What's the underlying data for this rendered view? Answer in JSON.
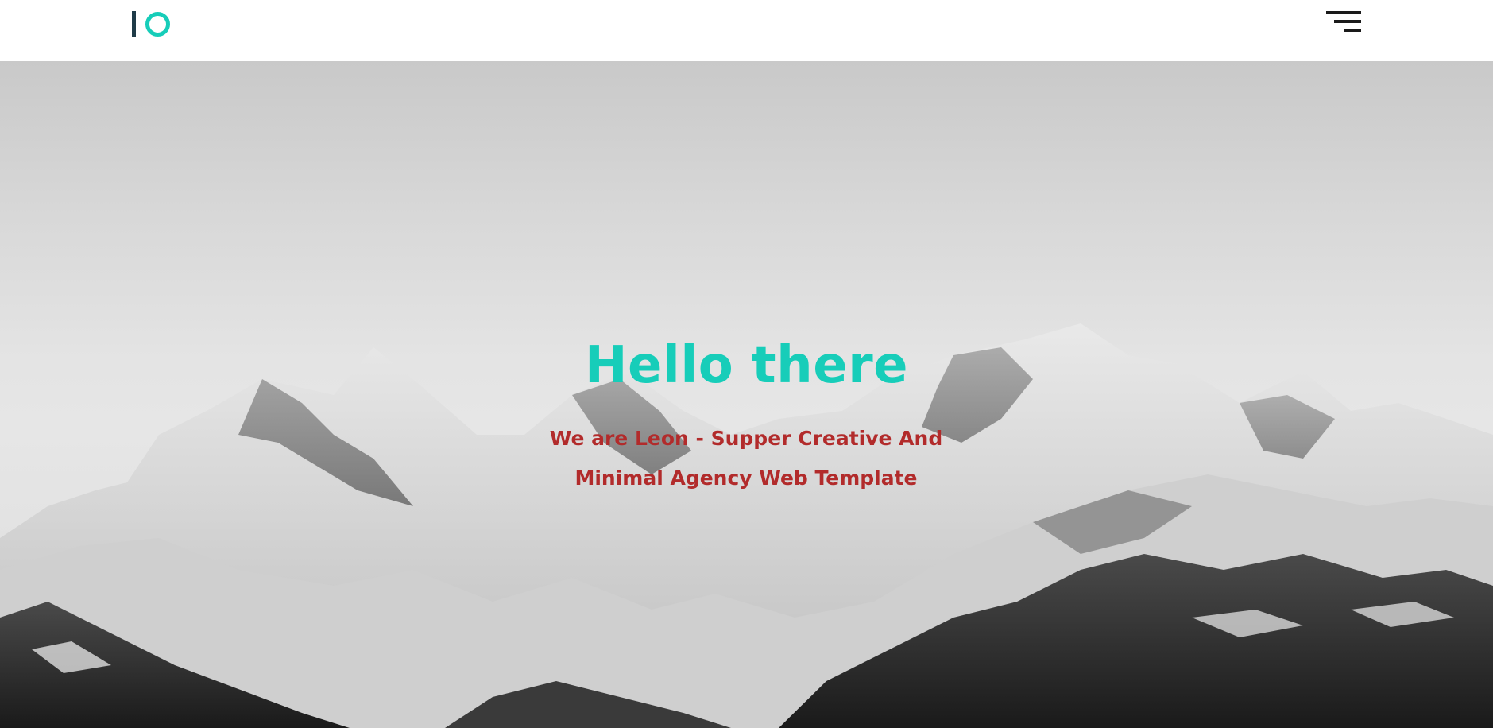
{
  "header": {
    "logo_icon": "logo-mark",
    "menu_icon": "hamburger-menu-icon"
  },
  "hero": {
    "title": "Hello there",
    "subtitle": "We are Leon - Supper Creative And Minimal Agency Web Template"
  },
  "colors": {
    "accent": "#17cdb9",
    "logo_dark": "#1f3b48",
    "subtitle": "#b22b2b",
    "menu": "#1a1a1a"
  }
}
